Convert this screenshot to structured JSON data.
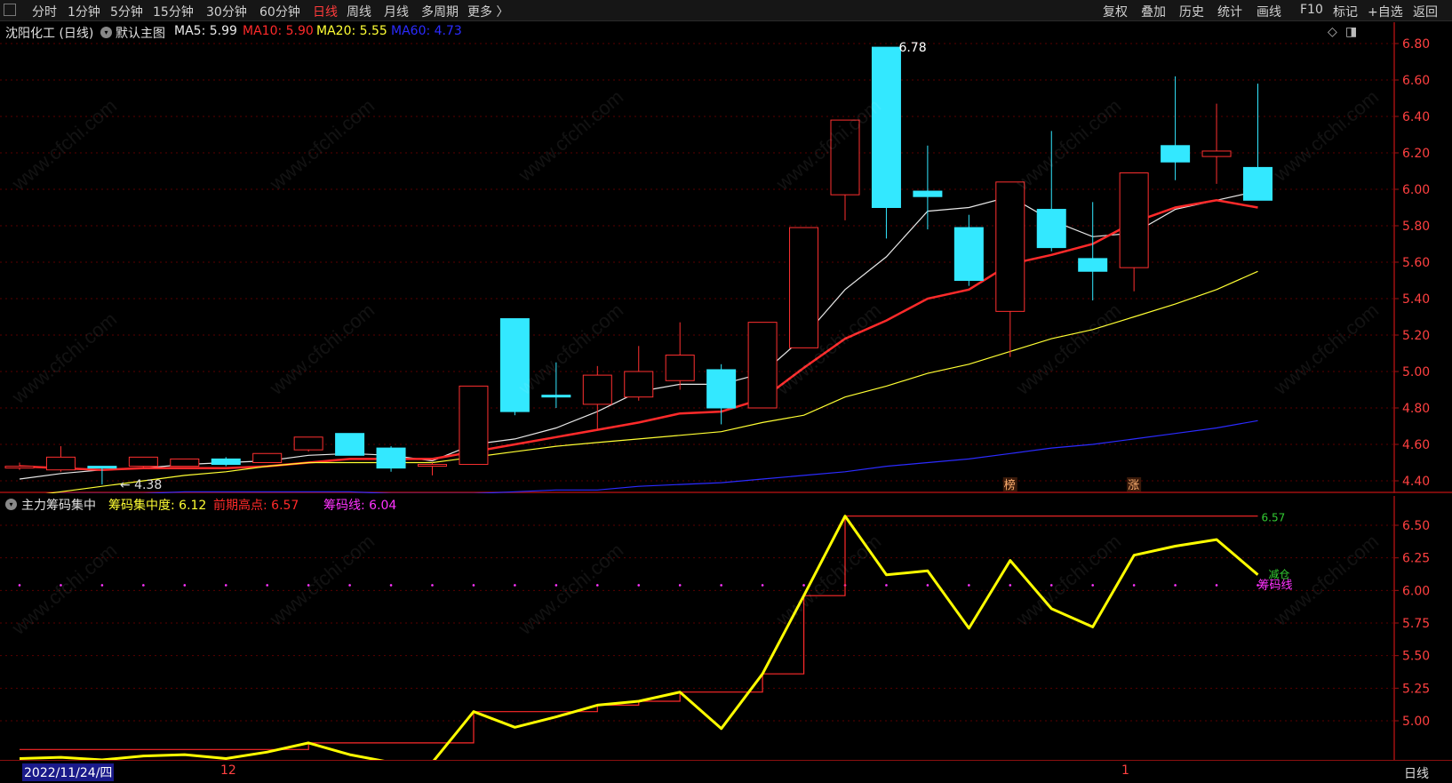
{
  "toolbar": {
    "left_items": [
      "分时",
      "1分钟",
      "5分钟",
      "15分钟",
      "30分钟",
      "60分钟",
      "日线",
      "周线",
      "月线",
      "多周期",
      "更多 〉"
    ],
    "active_item": "日线",
    "right_items": [
      "复权",
      "叠加",
      "历史",
      "统计",
      "画线",
      "F10",
      "标记",
      "+自选",
      "返回"
    ]
  },
  "main_chart": {
    "stock_title": "沈阳化工 (日线)",
    "template_label": "默认主图",
    "ma_legend": [
      {
        "label": "MA5: 5.99",
        "color": "#e8e8e8"
      },
      {
        "label": "MA10: 5.90",
        "color": "#ff2a2a"
      },
      {
        "label": "MA20: 5.55",
        "color": "#ffff33"
      },
      {
        "label": "MA60: 4.73",
        "color": "#2b2bff"
      }
    ],
    "high_annotation": "6.78",
    "low_annotation": "4.38",
    "event_markers": [
      "榜",
      "涨"
    ],
    "y_axis_ticks": [
      "6.80",
      "6.60",
      "6.40",
      "6.20",
      "6.00",
      "5.80",
      "5.60",
      "5.40",
      "5.20",
      "5.00",
      "4.80",
      "4.60",
      "4.40"
    ]
  },
  "indicator": {
    "name": "主力筹码集中",
    "concentration": "筹码集中度: 6.12",
    "prior_high": "前期高点: 6.57",
    "chip_line": "筹码线: 6.04",
    "right_high_label": "6.57",
    "right_tag_green": "减仓",
    "right_tag_magenta": "筹码线",
    "y_axis_ticks": [
      "6.50",
      "6.25",
      "6.00",
      "5.75",
      "5.50",
      "5.25",
      "5.00"
    ]
  },
  "date_bar": {
    "cursor_date": "2022/11/24/四",
    "month_marks": [
      "12",
      "1"
    ],
    "period_label": "日线"
  },
  "watermark_text": "www.cfchi.com",
  "chart_data": [
    {
      "type": "candlestick",
      "title": "沈阳化工 (日线)",
      "ylim": [
        4.3,
        6.9
      ],
      "candles": [
        {
          "o": 4.48,
          "c": 4.48,
          "h": 4.5,
          "l": 4.46
        },
        {
          "o": 4.46,
          "c": 4.53,
          "h": 4.59,
          "l": 4.45
        },
        {
          "o": 4.48,
          "c": 4.47,
          "h": 4.48,
          "l": 4.38
        },
        {
          "o": 4.48,
          "c": 4.53,
          "h": 4.53,
          "l": 4.47
        },
        {
          "o": 4.48,
          "c": 4.52,
          "h": 4.52,
          "l": 4.48
        },
        {
          "o": 4.52,
          "c": 4.49,
          "h": 4.53,
          "l": 4.48
        },
        {
          "o": 4.5,
          "c": 4.55,
          "h": 4.55,
          "l": 4.5
        },
        {
          "o": 4.57,
          "c": 4.64,
          "h": 4.64,
          "l": 4.56
        },
        {
          "o": 4.66,
          "c": 4.54,
          "h": 4.66,
          "l": 4.54
        },
        {
          "o": 4.58,
          "c": 4.47,
          "h": 4.59,
          "l": 4.45
        },
        {
          "o": 4.48,
          "c": 4.49,
          "h": 4.5,
          "l": 4.43
        },
        {
          "o": 4.49,
          "c": 4.92,
          "h": 4.92,
          "l": 4.49
        },
        {
          "o": 5.29,
          "c": 4.78,
          "h": 5.29,
          "l": 4.76
        },
        {
          "o": 4.87,
          "c": 4.86,
          "h": 5.05,
          "l": 4.8
        },
        {
          "o": 4.82,
          "c": 4.98,
          "h": 5.03,
          "l": 4.68
        },
        {
          "o": 4.86,
          "c": 5.0,
          "h": 5.14,
          "l": 4.84
        },
        {
          "o": 4.95,
          "c": 5.09,
          "h": 5.27,
          "l": 4.9
        },
        {
          "o": 5.01,
          "c": 4.8,
          "h": 5.04,
          "l": 4.71
        },
        {
          "o": 4.8,
          "c": 5.27,
          "h": 5.27,
          "l": 4.8
        },
        {
          "o": 5.13,
          "c": 5.79,
          "h": 5.79,
          "l": 5.13
        },
        {
          "o": 5.97,
          "c": 6.38,
          "h": 6.38,
          "l": 5.83
        },
        {
          "o": 6.78,
          "c": 5.9,
          "h": 6.78,
          "l": 5.73
        },
        {
          "o": 5.99,
          "c": 5.96,
          "h": 6.24,
          "l": 5.78
        },
        {
          "o": 5.79,
          "c": 5.5,
          "h": 5.86,
          "l": 5.47
        },
        {
          "o": 5.33,
          "c": 6.04,
          "h": 6.04,
          "l": 5.08
        },
        {
          "o": 5.89,
          "c": 5.68,
          "h": 6.32,
          "l": 5.66
        },
        {
          "o": 5.62,
          "c": 5.55,
          "h": 5.93,
          "l": 5.39
        },
        {
          "o": 5.57,
          "c": 6.09,
          "h": 6.09,
          "l": 5.44
        },
        {
          "o": 6.24,
          "c": 6.15,
          "h": 6.62,
          "l": 6.05
        },
        {
          "o": 6.18,
          "c": 6.21,
          "h": 6.47,
          "l": 6.03
        },
        {
          "o": 6.12,
          "c": 5.94,
          "h": 6.58,
          "l": 5.94
        }
      ],
      "series": [
        {
          "name": "MA5",
          "color": "#e8e8e8",
          "values": [
            4.41,
            4.44,
            4.46,
            4.47,
            4.49,
            4.5,
            4.51,
            4.54,
            4.55,
            4.54,
            4.51,
            4.6,
            4.63,
            4.69,
            4.78,
            4.89,
            4.93,
            4.93,
            4.99,
            5.19,
            5.45,
            5.63,
            5.88,
            5.9,
            5.96,
            5.83,
            5.74,
            5.76,
            5.89,
            5.94,
            5.99
          ]
        },
        {
          "name": "MA10",
          "color": "#ff2a2a",
          "values": [
            4.48,
            4.47,
            4.46,
            4.47,
            4.47,
            4.47,
            4.48,
            4.5,
            4.52,
            4.52,
            4.52,
            4.56,
            4.6,
            4.64,
            4.68,
            4.72,
            4.77,
            4.78,
            4.85,
            5.02,
            5.18,
            5.28,
            5.4,
            5.45,
            5.59,
            5.64,
            5.7,
            5.82,
            5.9,
            5.94,
            5.9
          ]
        },
        {
          "name": "MA20",
          "color": "#ffff33",
          "values": [
            4.31,
            4.34,
            4.37,
            4.4,
            4.43,
            4.45,
            4.48,
            4.5,
            4.5,
            4.5,
            4.5,
            4.53,
            4.56,
            4.59,
            4.61,
            4.63,
            4.65,
            4.67,
            4.72,
            4.76,
            4.86,
            4.92,
            4.99,
            5.04,
            5.11,
            5.18,
            5.23,
            5.3,
            5.37,
            5.45,
            5.55
          ]
        },
        {
          "name": "MA60",
          "color": "#2b2bff",
          "values": [
            4.32,
            4.33,
            4.33,
            4.33,
            4.34,
            4.34,
            4.34,
            4.34,
            4.34,
            4.33,
            4.33,
            4.33,
            4.34,
            4.35,
            4.35,
            4.37,
            4.38,
            4.39,
            4.41,
            4.43,
            4.45,
            4.48,
            4.5,
            4.52,
            4.55,
            4.58,
            4.6,
            4.63,
            4.66,
            4.69,
            4.73
          ]
        }
      ]
    },
    {
      "type": "line",
      "title": "主力筹码集中",
      "ylim": [
        4.8,
        6.7
      ],
      "series": [
        {
          "name": "筹码集中度",
          "color": "#ffff00",
          "values": [
            4.71,
            4.72,
            4.7,
            4.73,
            4.74,
            4.71,
            4.76,
            4.83,
            4.74,
            4.68,
            4.68,
            5.07,
            4.95,
            5.03,
            5.12,
            5.15,
            5.22,
            4.94,
            5.36,
            5.96,
            6.57,
            6.12,
            6.15,
            5.71,
            6.23,
            5.86,
            5.72,
            6.27,
            6.34,
            6.39,
            6.12
          ]
        },
        {
          "name": "前期高点",
          "color": "#ff2a2a",
          "values": [
            4.78,
            4.78,
            4.78,
            4.78,
            4.78,
            4.78,
            4.78,
            4.83,
            4.83,
            4.83,
            4.83,
            5.07,
            5.07,
            5.07,
            5.12,
            5.15,
            5.22,
            5.22,
            5.36,
            5.96,
            6.57,
            6.57,
            6.57,
            6.57,
            6.57,
            6.57,
            6.57,
            6.57,
            6.57,
            6.57,
            6.57
          ]
        },
        {
          "name": "筹码线",
          "color": "#ff00ff",
          "values": [
            6.04,
            6.04,
            6.04,
            6.04,
            6.04,
            6.04,
            6.04,
            6.04,
            6.04,
            6.04,
            6.04,
            6.04,
            6.04,
            6.04,
            6.04,
            6.04,
            6.04,
            6.04,
            6.04,
            6.04,
            6.04,
            6.04,
            6.04,
            6.04,
            6.04,
            6.04,
            6.04,
            6.04,
            6.04,
            6.04,
            6.04
          ]
        }
      ]
    }
  ]
}
